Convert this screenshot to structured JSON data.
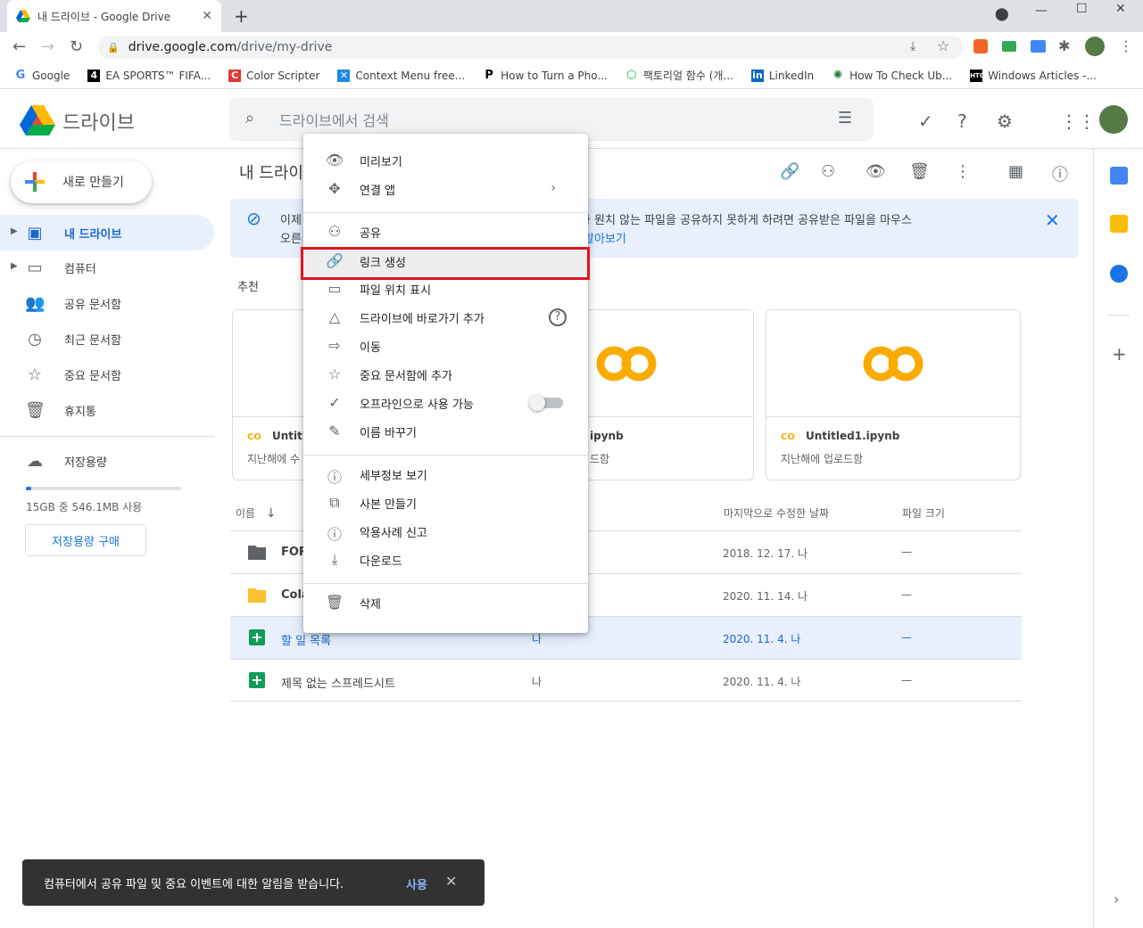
{
  "browser": {
    "tab_title": "내 드라이브 - Google Drive",
    "url_host": "drive.google.com",
    "url_path": "/drive/my-drive"
  },
  "bookmarks": [
    {
      "label": "Google"
    },
    {
      "label": "EA SPORTS™ FIFA..."
    },
    {
      "label": "Color Scripter"
    },
    {
      "label": "Context Menu free..."
    },
    {
      "label": "How to Turn a Pho..."
    },
    {
      "label": "팩토리얼 함수 (개..."
    },
    {
      "label": "LinkedIn"
    },
    {
      "label": "How To Check Ub..."
    },
    {
      "label": "Windows Articles -..."
    }
  ],
  "app": {
    "name": "드라이브",
    "search_placeholder": "드라이브에서 검색"
  },
  "sidebar": {
    "new_label": "새로 만들기",
    "items": [
      {
        "label": "내 드라이브",
        "icon": "drive-icon",
        "active": true
      },
      {
        "label": "컴퓨터",
        "icon": "computer-icon"
      },
      {
        "label": "공유 문서함",
        "icon": "people-icon"
      },
      {
        "label": "최근 문서함",
        "icon": "clock-icon"
      },
      {
        "label": "중요 문서함",
        "icon": "star-icon"
      },
      {
        "label": "휴지통",
        "icon": "trash-icon"
      }
    ],
    "storage_label": "저장용량",
    "storage_usage": "15GB 중 546.1MB 사용",
    "storage_fraction": 0.036,
    "buy_label": "저장용량 구매"
  },
  "main": {
    "title": "내 드라이",
    "banner_line1": "이제",
    "banner_line1_end": "용자가 나와 원치 않는 파일을 공유하지 못하게 하려면 공유받은 파일을 마우스",
    "banner_line2": "오른",
    "banner_link": "히 알아보기",
    "recommended_label": "추천",
    "cards": [
      {
        "name": "Untitle",
        "sub": "지난해에 수"
      },
      {
        "name": "ipynb",
        "sub": "드함"
      },
      {
        "name": "Untitled1.ipynb",
        "sub": "지난해에 업로드함"
      }
    ],
    "columns": {
      "name": "이름",
      "modified": "마지막으로 수정한 날짜",
      "size": "파일 크기"
    },
    "rows": [
      {
        "name": "FOR",
        "owner": "",
        "date": "2018. 12. 17. 나",
        "size": "—",
        "type": "folder-dark"
      },
      {
        "name": "Cola",
        "owner": "",
        "date": "2020. 11. 14. 나",
        "size": "—",
        "type": "folder-yellow"
      },
      {
        "name": "할 일 목록",
        "owner": "나",
        "date": "2020. 11. 4. 나",
        "size": "—",
        "type": "sheet",
        "selected": true
      },
      {
        "name": "제목 없는 스프레드시트",
        "owner": "나",
        "date": "2020. 11. 4. 나",
        "size": "—",
        "type": "sheet"
      }
    ]
  },
  "context_menu": {
    "items": [
      "미리보기",
      "연결 앱",
      "공유",
      "링크 생성",
      "파일 위치 표시",
      "드라이브에 바로가기 추가",
      "이동",
      "중요 문서함에 추가",
      "오프라인으로 사용 가능",
      "이름 바꾸기",
      "세부정보 보기",
      "사본 만들기",
      "악용사례 신고",
      "다운로드",
      "삭제"
    ],
    "highlighted": "링크 생성"
  },
  "toast": {
    "message": "컴퓨터에서 공유 파일 및 중요 이벤트에 대한 알림을 받습니다.",
    "action": "사용"
  },
  "colors": {
    "accent": "#1a73e8",
    "highlight_border": "#e0141e"
  }
}
